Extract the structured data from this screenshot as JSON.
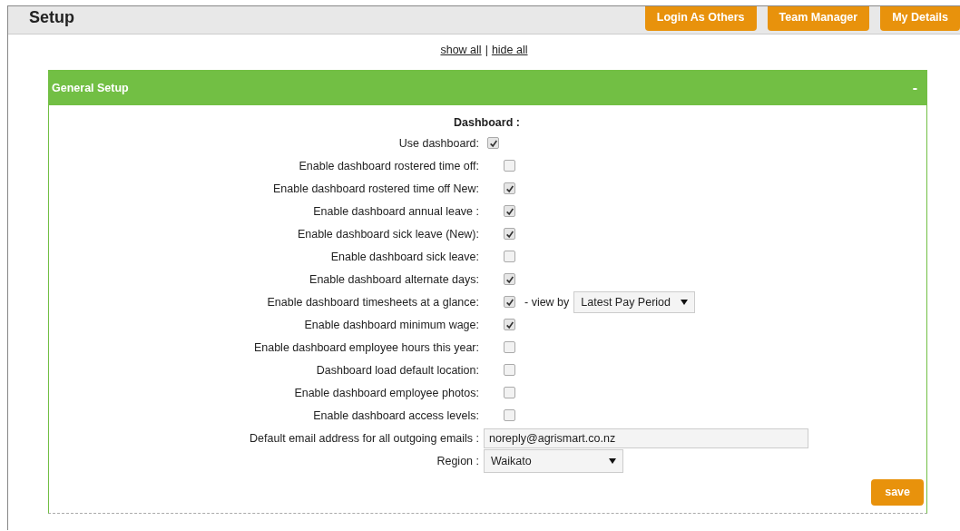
{
  "header": {
    "title": "Setup",
    "buttons": [
      "Login As Others",
      "Team Manager",
      "My Details"
    ]
  },
  "links": [
    "show all",
    "hide all"
  ],
  "link_separator": "|",
  "panel": {
    "title": "General Setup",
    "collapse": "-",
    "section": "Dashboard :",
    "rows": [
      {
        "kind": "inline-checkbox",
        "label": "Use dashboard:",
        "checked": true
      },
      {
        "kind": "checkbox",
        "label": "Enable dashboard rostered time off:",
        "checked": false
      },
      {
        "kind": "checkbox",
        "label": "Enable dashboard rostered time off New:",
        "checked": true
      },
      {
        "kind": "checkbox",
        "label": "Enable dashboard annual leave :",
        "checked": true
      },
      {
        "kind": "checkbox",
        "label": "Enable dashboard sick leave (New):",
        "checked": true
      },
      {
        "kind": "checkbox",
        "label": "Enable dashboard sick leave:",
        "checked": false
      },
      {
        "kind": "checkbox",
        "label": "Enable dashboard alternate days:",
        "checked": true
      },
      {
        "kind": "checkbox-select",
        "label": "Enable dashboard timesheets at a glance:",
        "checked": true,
        "suffix": "- view by",
        "value": "Latest Pay Period"
      },
      {
        "kind": "checkbox",
        "label": "Enable dashboard minimum wage:",
        "checked": true
      },
      {
        "kind": "checkbox",
        "label": "Enable dashboard employee hours this year:",
        "checked": false
      },
      {
        "kind": "checkbox",
        "label": "Dashboard load default location:",
        "checked": false
      },
      {
        "kind": "checkbox",
        "label": "Enable dashboard employee photos:",
        "checked": false
      },
      {
        "kind": "checkbox",
        "label": "Enable dashboard access levels:",
        "checked": false
      },
      {
        "kind": "text",
        "label": "Default email address for all outgoing emails :",
        "value": "noreply@agrismart.co.nz"
      },
      {
        "kind": "select",
        "label": "Region :",
        "value": "Waikato"
      }
    ],
    "save": "save"
  }
}
